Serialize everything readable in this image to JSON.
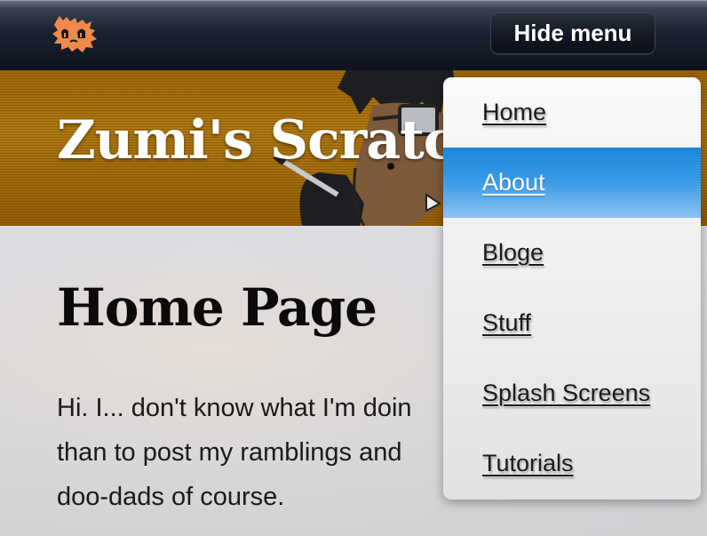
{
  "topbar": {
    "logo_icon": "cat-logo-icon",
    "hide_menu_label": "Hide menu"
  },
  "banner": {
    "site_title": "Zumi's Scratch",
    "art": "cartoon-character-art"
  },
  "main": {
    "page_title": "Home Page",
    "intro_lines": [
      "Hi. I... don't know what I'm doin",
      "than to post my ramblings and",
      "doo-dads of course."
    ]
  },
  "menu": {
    "items": [
      {
        "label": "Home",
        "active": false
      },
      {
        "label": "About",
        "active": true
      },
      {
        "label": "Bloge",
        "active": false
      },
      {
        "label": "Stuff",
        "active": false
      },
      {
        "label": "Splash Screens",
        "active": false
      },
      {
        "label": "Tutorials",
        "active": false
      }
    ]
  },
  "colors": {
    "topbar": "#131823",
    "banner": "#a56a08",
    "menu_active": "#1a87de",
    "logo": "#f08a4b"
  }
}
